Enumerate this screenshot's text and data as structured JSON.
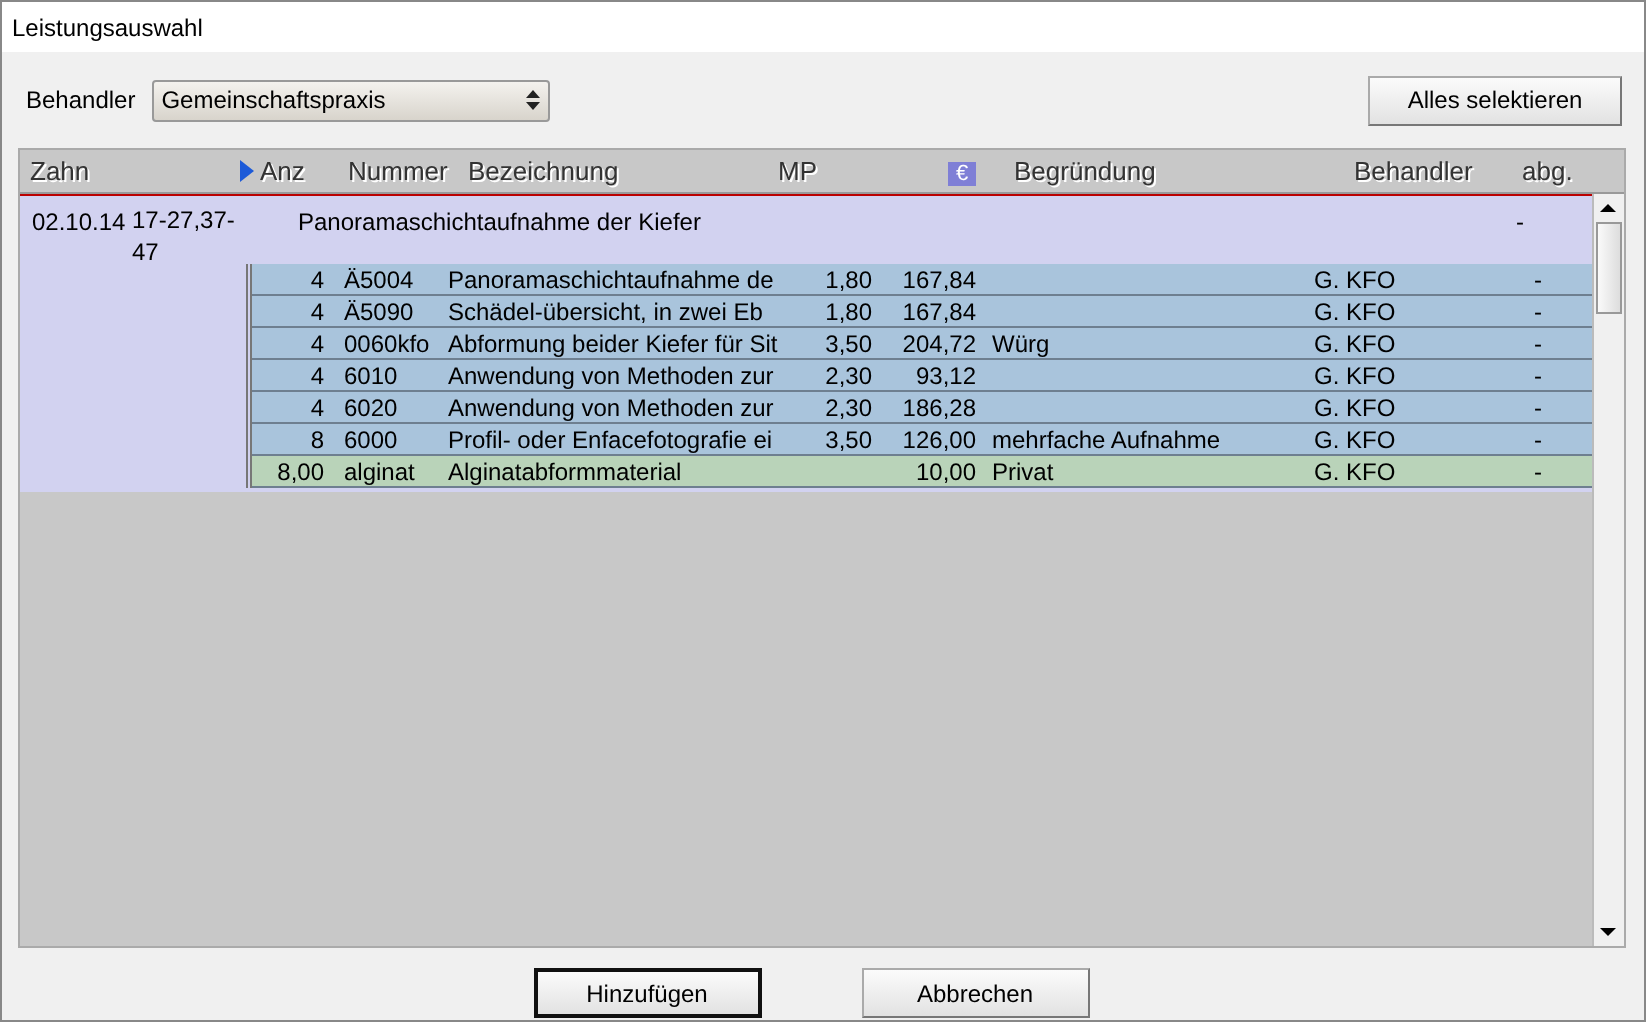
{
  "window": {
    "title": "Leistungsauswahl"
  },
  "filter": {
    "label": "Behandler",
    "value": "Gemeinschaftspraxis"
  },
  "select_all_button": "Alles selektieren",
  "table": {
    "columns": [
      "Zahn",
      "Anz",
      "Nummer",
      "Bezeichnung",
      "MP",
      "€",
      "Begründung",
      "Behandler",
      "abg."
    ],
    "groups": [
      {
        "date": "02.10.14",
        "teeth": "17-27,37-47",
        "description": "Panoramaschichtaufnahme der Kiefer",
        "billed": "-",
        "items": [
          {
            "kind": "service",
            "count": "4",
            "number": "Ä5004",
            "description": "Panoramaschichtaufnahme de",
            "mp": "1,80",
            "amount": "167,84",
            "provider": "G. KFO",
            "billed": "-"
          },
          {
            "kind": "service",
            "count": "4",
            "number": "Ä5090",
            "description": "Schädel-übersicht, in zwei Eb",
            "mp": "1,80",
            "amount": "167,84",
            "provider": "G. KFO",
            "billed": "-"
          },
          {
            "kind": "service",
            "count": "4",
            "number": "0060kfo",
            "description": "Abformung beider Kiefer für Sit",
            "mp": "3,50",
            "amount": "204,72",
            "reason": "Würg",
            "provider": "G. KFO",
            "billed": "-"
          },
          {
            "kind": "service",
            "count": "4",
            "number": "6010",
            "description": "Anwendung von Methoden zur",
            "mp": "2,30",
            "amount": "93,12",
            "provider": "G. KFO",
            "billed": "-"
          },
          {
            "kind": "service",
            "count": "4",
            "number": "6020",
            "description": "Anwendung von Methoden zur",
            "mp": "2,30",
            "amount": "186,28",
            "provider": "G. KFO",
            "billed": "-"
          },
          {
            "kind": "service",
            "count": "8",
            "number": "6000",
            "description": "Profil- oder Enfacefotografie ei",
            "mp": "3,50",
            "amount": "126,00",
            "reason": "mehrfache Aufnahme",
            "provider": "G. KFO",
            "billed": "-"
          },
          {
            "kind": "material",
            "count": "8,00",
            "number": "alginat",
            "description": "Alginatabformmaterial",
            "amount": "10,00",
            "reason": "Privat",
            "provider": "G. KFO",
            "billed": "-"
          }
        ]
      }
    ]
  },
  "buttons": [
    {
      "label": "Hinzufügen",
      "default": true
    },
    {
      "label": "Abbrechen",
      "default": false
    }
  ]
}
